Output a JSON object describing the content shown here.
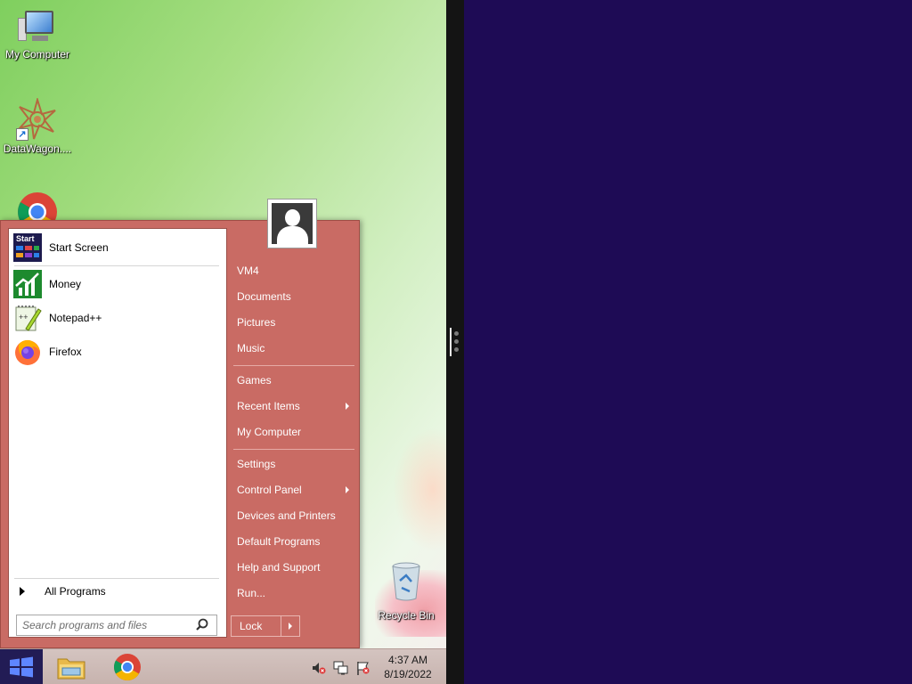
{
  "desktop": {
    "icons": [
      {
        "label": "My Computer",
        "icon": "computer-icon"
      },
      {
        "label": "DataWagon....",
        "icon": "datawagon-icon"
      },
      {
        "label": "",
        "icon": "chrome-icon"
      },
      {
        "label": "Recycle Bin",
        "icon": "recycle-bin-icon"
      }
    ]
  },
  "start_menu": {
    "programs": [
      {
        "label": "Start Screen",
        "icon": "start-screen-icon",
        "icon_text": "Start"
      },
      {
        "label": "Money",
        "icon": "money-icon"
      },
      {
        "label": "Notepad++",
        "icon": "notepad-plus-plus-icon"
      },
      {
        "label": "Firefox",
        "icon": "firefox-icon"
      }
    ],
    "all_programs_label": "All Programs",
    "search_placeholder": "Search programs and files",
    "places": [
      {
        "label": "VM4"
      },
      {
        "label": "Documents"
      },
      {
        "label": "Pictures"
      },
      {
        "label": "Music"
      },
      {
        "label": "Games"
      },
      {
        "label": "Recent Items",
        "submenu": true
      },
      {
        "label": "My Computer"
      },
      {
        "label": "Settings"
      },
      {
        "label": "Control Panel",
        "submenu": true
      },
      {
        "label": "Devices and Printers"
      },
      {
        "label": "Default Programs"
      },
      {
        "label": "Help and Support"
      },
      {
        "label": "Run..."
      }
    ],
    "lock_label": "Lock"
  },
  "taskbar": {
    "time": "4:37 AM",
    "date": "8/19/2022",
    "pinned": [
      "file-explorer-icon",
      "chrome-icon"
    ],
    "tray": [
      "volume-muted-icon",
      "network-icon",
      "action-center-flag-icon"
    ]
  },
  "colors": {
    "start_menu_bg": "#c96b64",
    "right_pane_bg": "#1e0b55",
    "start_button_bg": "#221c55"
  }
}
